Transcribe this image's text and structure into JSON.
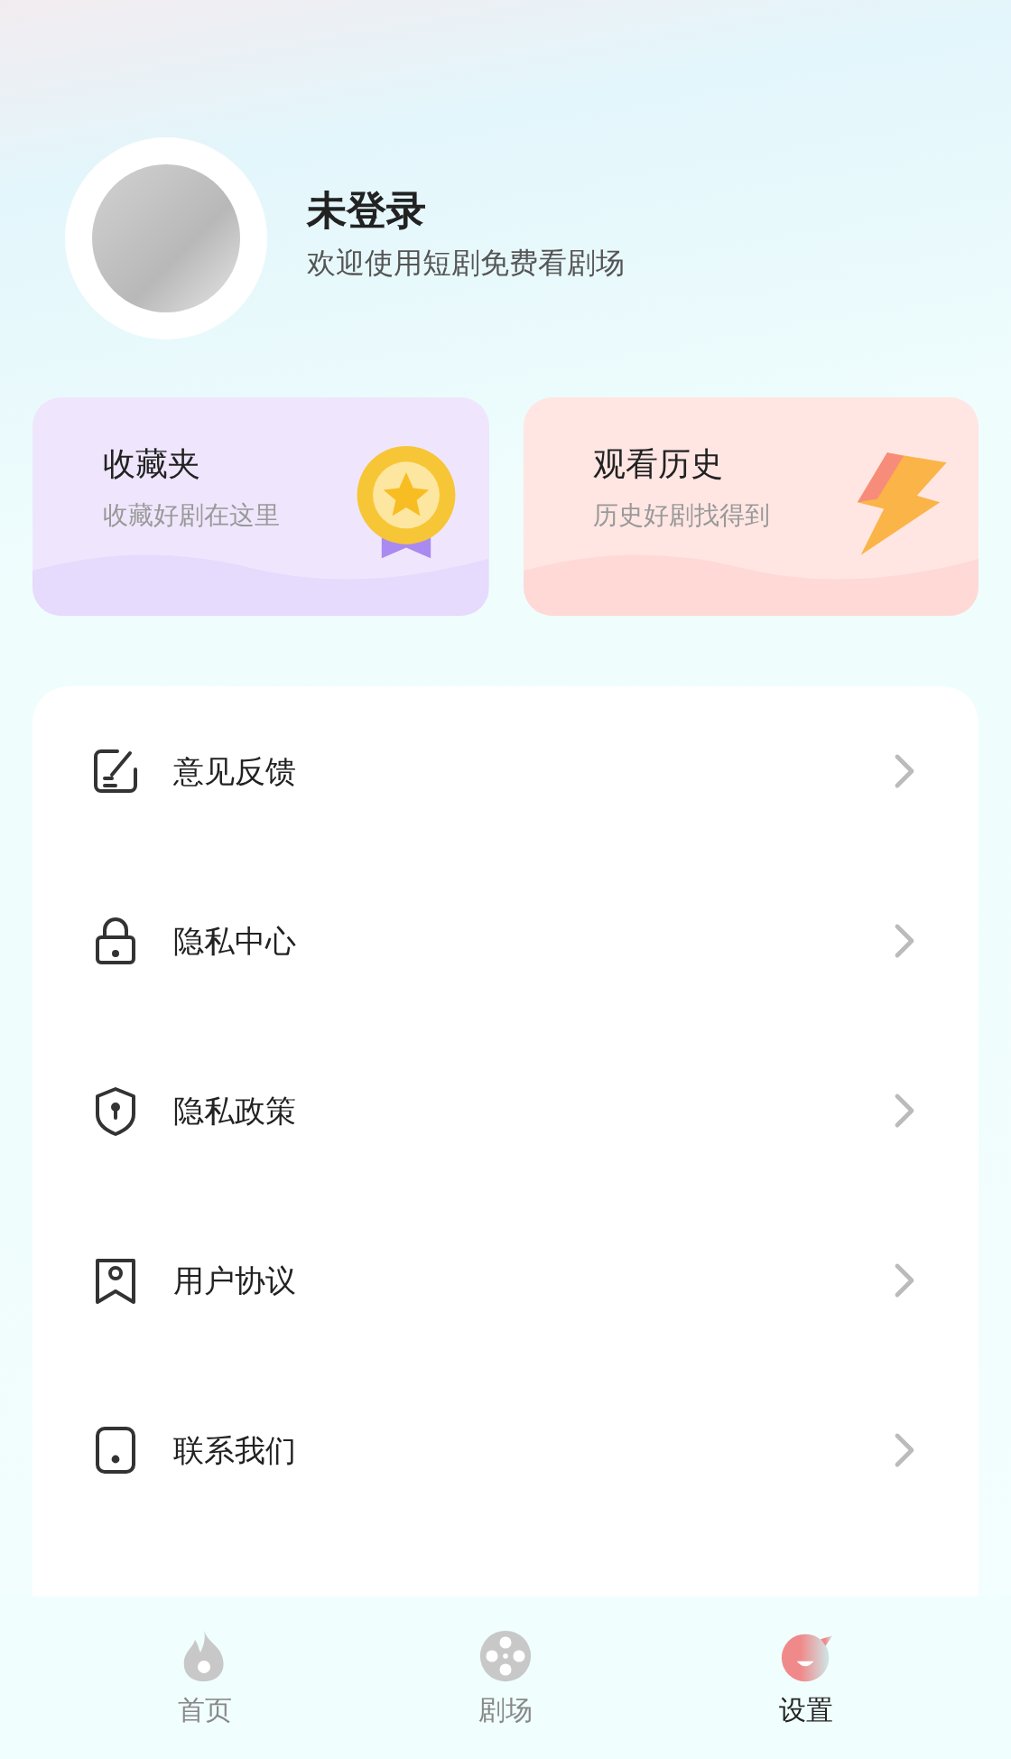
{
  "profile": {
    "name": "未登录",
    "subtitle": "欢迎使用短剧免费看剧场"
  },
  "cards": [
    {
      "kind": "favorites",
      "title": "收藏夹",
      "subtitle": "收藏好剧在这里"
    },
    {
      "kind": "history",
      "title": "观看历史",
      "subtitle": "历史好剧找得到"
    }
  ],
  "menu": [
    {
      "kind": "feedback",
      "label": "意见反馈"
    },
    {
      "kind": "lock",
      "label": "隐私中心"
    },
    {
      "kind": "shield",
      "label": "隐私政策"
    },
    {
      "kind": "agreement",
      "label": "用户协议"
    },
    {
      "kind": "contact",
      "label": "联系我们"
    }
  ],
  "tabs": [
    {
      "kind": "flame",
      "label": "首页",
      "selected": false
    },
    {
      "kind": "reel",
      "label": "剧场",
      "selected": false
    },
    {
      "kind": "face",
      "label": "设置",
      "selected": true
    }
  ]
}
